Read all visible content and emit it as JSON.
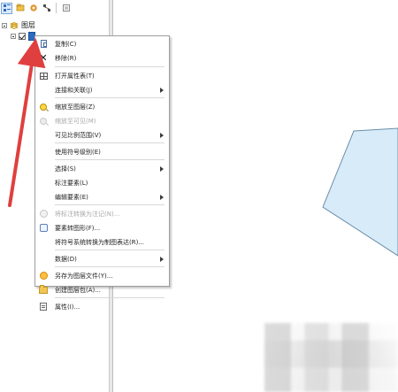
{
  "toc": {
    "layer_group_label": "图层"
  },
  "context_menu": {
    "items": [
      {
        "label": "复制(C)",
        "enabled": true,
        "icon": "copy-icon"
      },
      {
        "label": "移除(R)",
        "enabled": true,
        "icon": "remove-icon"
      },
      {
        "label": "打开属性表(T)",
        "enabled": true,
        "icon": "table-icon"
      },
      {
        "label": "连接和关联(J)",
        "enabled": true,
        "icon": ""
      },
      {
        "label": "缩放至图层(Z)",
        "enabled": true,
        "icon": "zoom-layer-icon"
      },
      {
        "label": "缩放至可见(M)",
        "enabled": false,
        "icon": "zoom-visible-icon"
      },
      {
        "label": "可见比例范围(V)",
        "enabled": true,
        "icon": ""
      },
      {
        "label": "使用符号级别(E)",
        "enabled": true,
        "icon": ""
      },
      {
        "label": "选择(S)",
        "enabled": true,
        "icon": ""
      },
      {
        "label": "标注要素(L)",
        "enabled": true,
        "icon": ""
      },
      {
        "label": "编辑要素(E)",
        "enabled": true,
        "icon": ""
      },
      {
        "label": "将标注转换为注记(N)...",
        "enabled": false,
        "icon": "convert-disabled-icon"
      },
      {
        "label": "要素转图形(F)...",
        "enabled": true,
        "icon": "convert-icon"
      },
      {
        "label": "将符号系统转换为制图表达(R)...",
        "enabled": true,
        "icon": ""
      },
      {
        "label": "数据(D)",
        "enabled": true,
        "icon": ""
      },
      {
        "label": "另存为图层文件(Y)...",
        "enabled": true,
        "icon": "save-layer-icon"
      },
      {
        "label": "创建图层包(A)...",
        "enabled": true,
        "icon": "package-icon"
      },
      {
        "label": "属性(I)...",
        "enabled": true,
        "icon": "properties-icon"
      }
    ]
  },
  "colors": {
    "polygon_fill": "#d7ebf8",
    "polygon_stroke": "#6c8fa9",
    "annotation_red": "#e03f3f"
  }
}
